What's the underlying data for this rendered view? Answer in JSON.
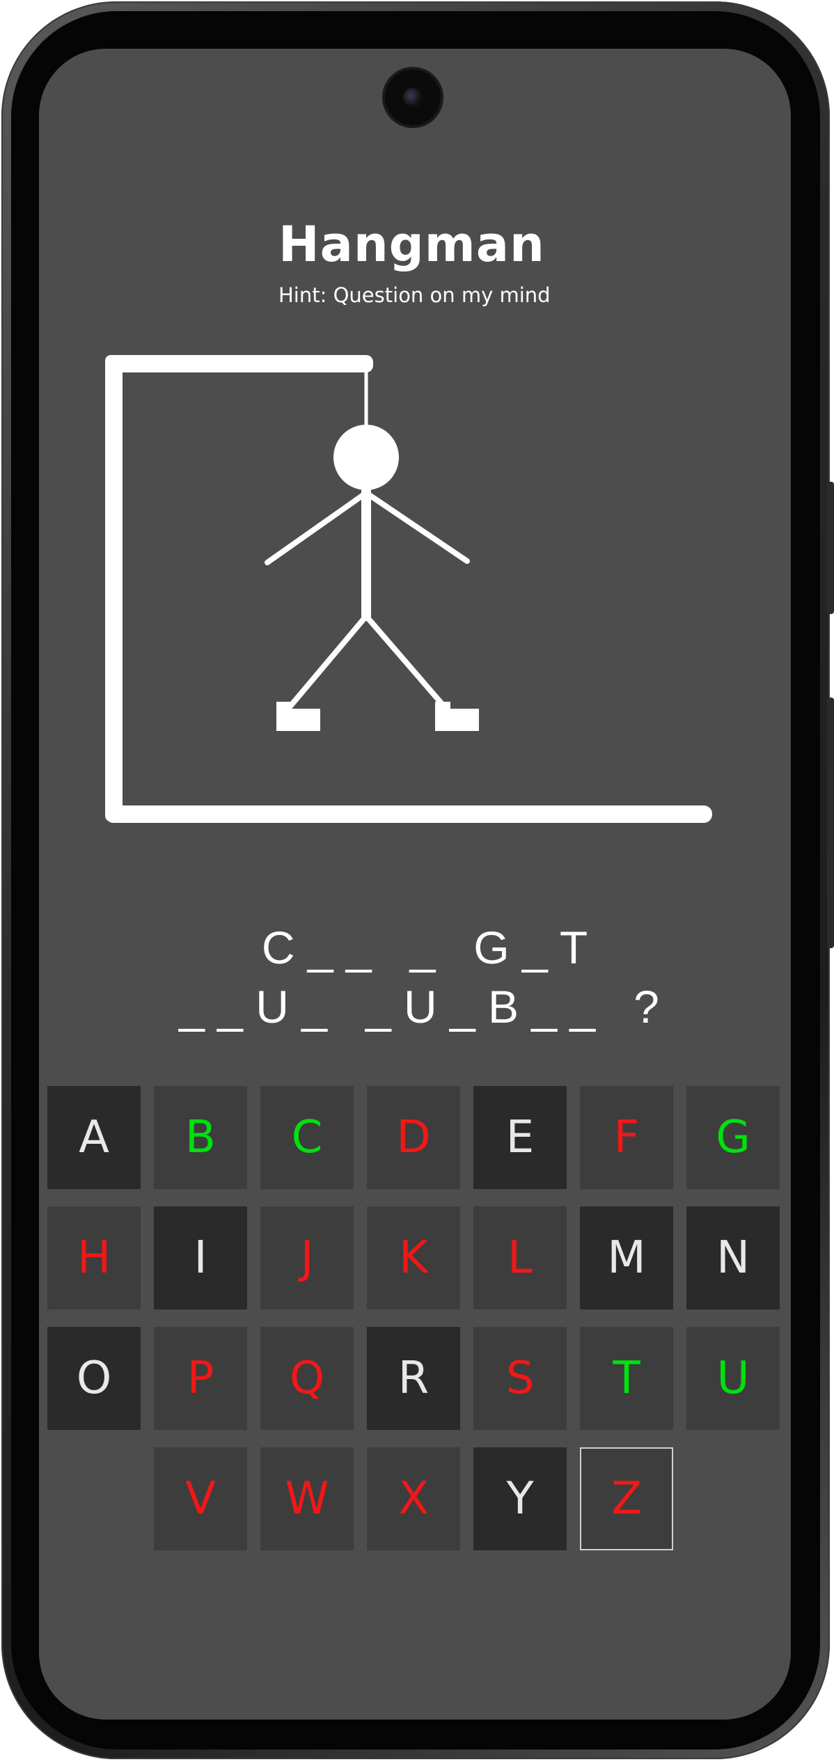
{
  "game": {
    "title": "Hangman",
    "hint": "Hint: Question on my mind"
  },
  "puzzle": {
    "line1": "C _ _   _   G _ T",
    "line2": "_ _ U _   _ U _ B _ _   ?"
  },
  "keyboard": {
    "colors": {
      "hit": "#00e10f",
      "miss": "#f01818",
      "available": "#e8e8e8"
    },
    "rows": [
      [
        {
          "letter": "A",
          "state": "available"
        },
        {
          "letter": "B",
          "state": "hit"
        },
        {
          "letter": "C",
          "state": "hit"
        },
        {
          "letter": "D",
          "state": "miss"
        },
        {
          "letter": "E",
          "state": "available"
        },
        {
          "letter": "F",
          "state": "miss"
        },
        {
          "letter": "G",
          "state": "hit"
        }
      ],
      [
        {
          "letter": "H",
          "state": "miss"
        },
        {
          "letter": "I",
          "state": "available"
        },
        {
          "letter": "J",
          "state": "miss"
        },
        {
          "letter": "K",
          "state": "miss"
        },
        {
          "letter": "L",
          "state": "miss"
        },
        {
          "letter": "M",
          "state": "available"
        },
        {
          "letter": "N",
          "state": "available"
        }
      ],
      [
        {
          "letter": "O",
          "state": "available"
        },
        {
          "letter": "P",
          "state": "miss"
        },
        {
          "letter": "Q",
          "state": "miss"
        },
        {
          "letter": "R",
          "state": "available"
        },
        {
          "letter": "S",
          "state": "miss"
        },
        {
          "letter": "T",
          "state": "hit"
        },
        {
          "letter": "U",
          "state": "hit"
        }
      ],
      [
        {
          "letter": "V",
          "state": "miss"
        },
        {
          "letter": "W",
          "state": "miss"
        },
        {
          "letter": "X",
          "state": "miss"
        },
        {
          "letter": "Y",
          "state": "available"
        },
        {
          "letter": "Z",
          "state": "miss",
          "focused": true
        }
      ]
    ]
  }
}
